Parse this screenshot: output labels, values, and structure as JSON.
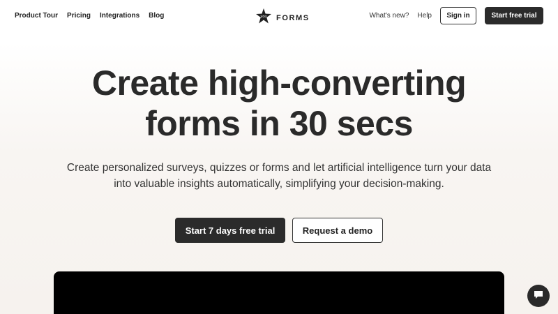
{
  "nav": {
    "links": [
      "Product Tour",
      "Pricing",
      "Integrations",
      "Blog"
    ],
    "brand": "FORMS",
    "whats_new": "What's new?",
    "help": "Help",
    "sign_in": "Sign in",
    "start_trial": "Start free trial"
  },
  "hero": {
    "title_line1": "Create high-converting",
    "title_line2": "forms in 30 secs",
    "subtitle_line1": "Create personalized surveys, quizzes or forms and let artificial intelligence turn your data",
    "subtitle_line2": "into valuable insights automatically, simplifying your decision-making.",
    "primary_cta": "Start 7 days free trial",
    "secondary_cta": "Request a demo"
  },
  "icons": {
    "logo": "star-badge-logo-icon",
    "chat": "chat-bubble-icon"
  },
  "colors": {
    "primary": "#2b2b2b",
    "text": "#222222",
    "background": "#f8f5f2"
  }
}
